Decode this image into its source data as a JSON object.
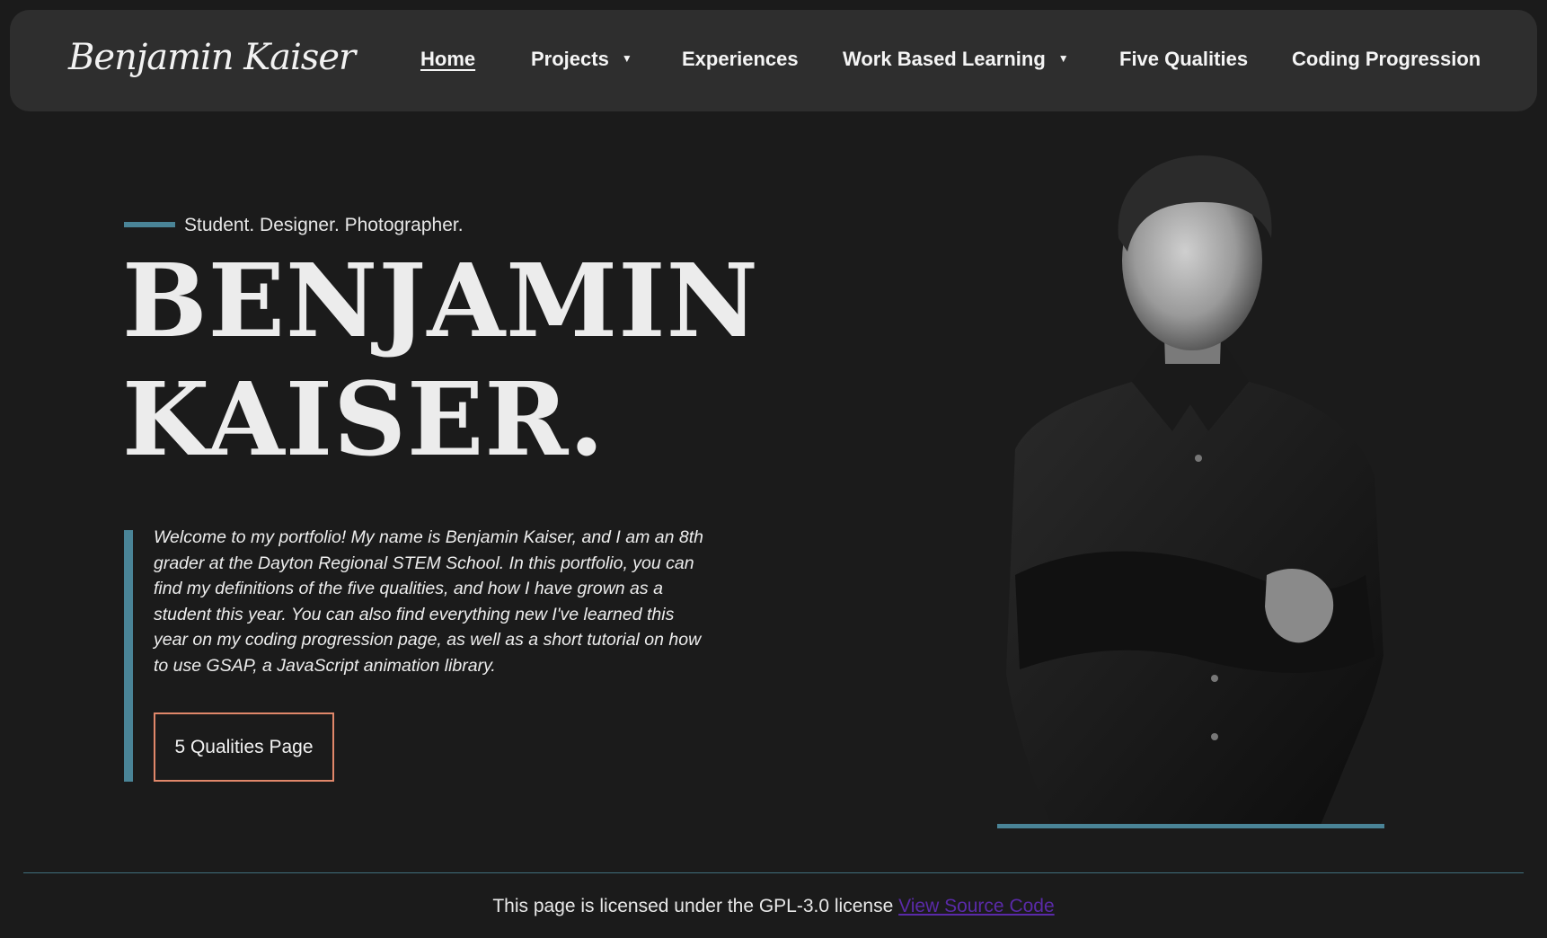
{
  "nav": {
    "brand": "Benjamin Kaiser",
    "items": [
      {
        "label": "Home"
      },
      {
        "label": "Projects"
      },
      {
        "label": "Experiences"
      },
      {
        "label": "Work Based Learning"
      },
      {
        "label": "Five Qualities"
      },
      {
        "label": "Coding Progression"
      }
    ]
  },
  "hero": {
    "tagline": "Student. Designer. Photographer.",
    "name_line1": "BENJAMIN",
    "name_line2": "KAISER.",
    "intro": "Welcome to my portfolio! My name is Benjamin Kaiser, and I am an 8th grader at the Dayton Regional STEM School. In this portfolio, you can find my definitions of the five qualities, and how I have grown as a student this year. You can also find everything new I've learned this year on my coding progression page, as well as a short tutorial on how to use GSAP, a JavaScript animation library.",
    "cta_label": "5 Qualities Page"
  },
  "footer": {
    "text": "This page is licensed under the GPL-3.0 license",
    "link_label": "View Source Code"
  },
  "colors": {
    "background": "#1b1b1b",
    "navbar": "#2e2e2e",
    "accent_teal": "#4a8497",
    "button_border": "#e0876a",
    "link": "#5a2aa8"
  }
}
